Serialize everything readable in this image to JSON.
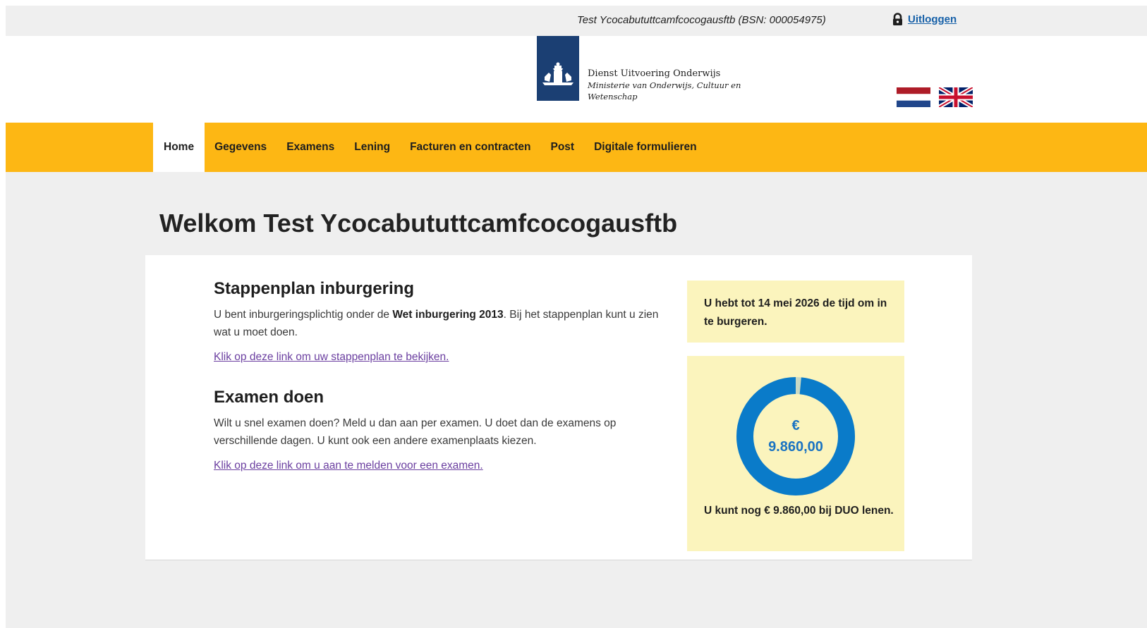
{
  "topbar": {
    "user_info": "Test Ycocabututtcamfcocogausftb (BSN: 000054975)",
    "logout_label": "Uitloggen"
  },
  "header": {
    "org_name": "Dienst Uitvoering Onderwijs",
    "ministry_line1": "Ministerie van Onderwijs, Cultuur en",
    "ministry_line2": "Wetenschap",
    "logo_color": "#1b3f73"
  },
  "nav": {
    "items": [
      {
        "label": "Home",
        "active": true
      },
      {
        "label": "Gegevens"
      },
      {
        "label": "Examens"
      },
      {
        "label": "Lening"
      },
      {
        "label": "Facturen en contracten"
      },
      {
        "label": "Post"
      },
      {
        "label": "Digitale formulieren"
      }
    ],
    "accent_color": "#fdb714"
  },
  "main": {
    "welcome": "Welkom Test Ycocabututtcamfcocogausftb",
    "stappenplan": {
      "title": "Stappenplan inburgering",
      "text_before": "U bent inburgeringsplichtig onder de ",
      "text_bold": "Wet inburgering 2013",
      "text_after": ". Bij het stappenplan kunt u zien wat u moet doen.",
      "link": "Klik op deze link om uw stappenplan te bekijken."
    },
    "examen": {
      "title": "Examen doen",
      "text": "Wilt u snel examen doen? Meld u dan aan per examen. U doet dan de examens op verschillende dagen. U kunt ook een andere examenplaats kiezen.",
      "link": "Klik op deze link om u aan te melden voor een examen."
    },
    "deadline_box": {
      "text": "U hebt tot 14 mei 2026 de tijd om in te burgeren."
    },
    "loan_box": {
      "currency": "€",
      "amount": "9.860,00",
      "text": "U kunt nog € 9.860,00 bij DUO lenen.",
      "remaining_fraction": 0.985,
      "ring_color": "#0a7bc9",
      "used_color": "#c9d9c4"
    }
  }
}
